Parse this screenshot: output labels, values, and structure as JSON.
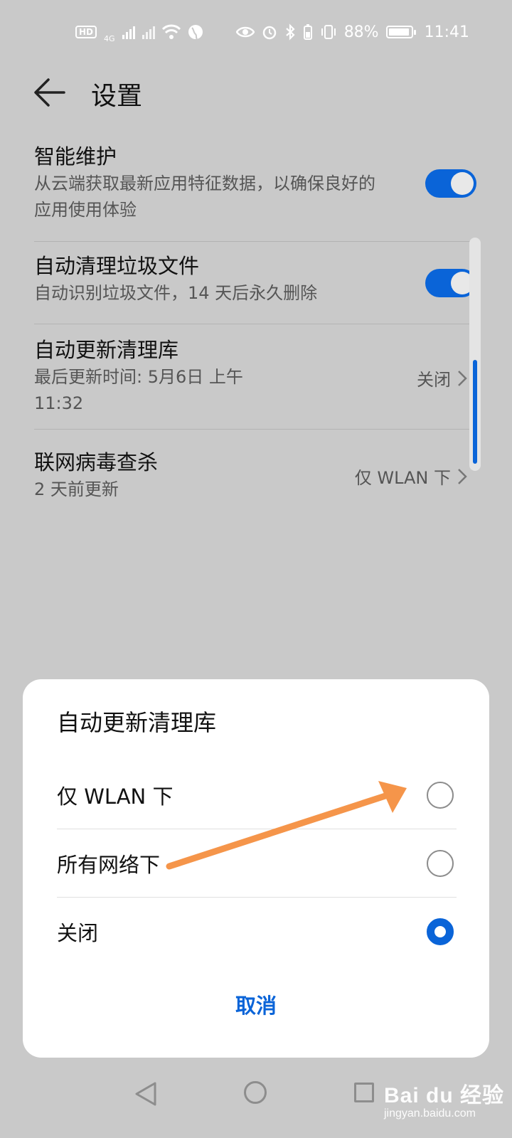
{
  "status_bar": {
    "hd": "HD",
    "network": "4G",
    "battery": "88%",
    "time": "11:41"
  },
  "header": {
    "title": "设置"
  },
  "settings": [
    {
      "title": "智能维护",
      "subtitle": "从云端获取最新应用特征数据，以确保良好的应用使用体验",
      "toggle": true
    },
    {
      "title": "自动清理垃圾文件",
      "subtitle": "自动识别垃圾文件，14 天后永久删除",
      "toggle": true
    },
    {
      "title": "自动更新清理库",
      "subtitle": "最后更新时间: 5月6日 上午 11:32",
      "value": "关闭"
    },
    {
      "title": "联网病毒查杀",
      "subtitle": "2 天前更新",
      "value": "仅 WLAN 下"
    }
  ],
  "dialog": {
    "title": "自动更新清理库",
    "options": [
      {
        "label": "仅 WLAN 下",
        "selected": false
      },
      {
        "label": "所有网络下",
        "selected": false
      },
      {
        "label": "关闭",
        "selected": true
      }
    ],
    "cancel": "取消"
  },
  "watermark": {
    "main": "Bai du 经验",
    "sub": "jingyan.baidu.com"
  },
  "colors": {
    "accent": "#0a64d8",
    "annotation_arrow": "#f5954a"
  }
}
